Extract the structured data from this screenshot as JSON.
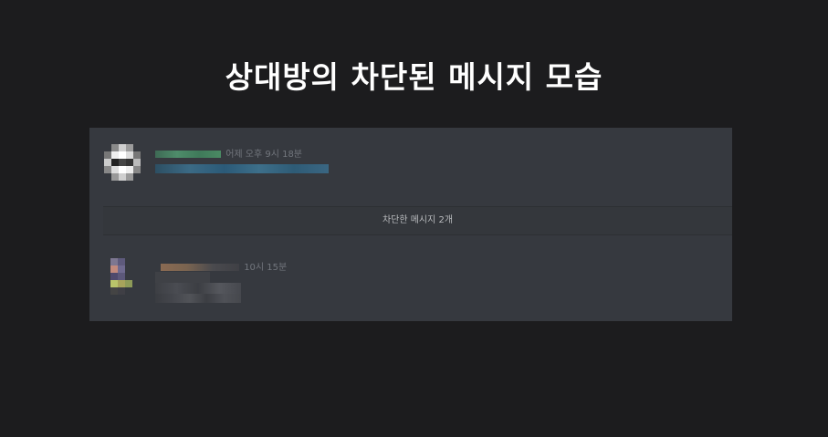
{
  "page": {
    "title": "상대방의 차단된 메시지 모습"
  },
  "messages": [
    {
      "timestamp": "어제 오후 9시 18분"
    },
    {
      "timestamp": "10시 15분"
    }
  ],
  "blocked_notice": {
    "label": "차단한 메시지 2개"
  },
  "colors": {
    "background": "#1c1c1e",
    "panel": "#36393f",
    "timestamp": "#72767d",
    "username_green": "#43b581",
    "link_blue": "#00b0f4"
  }
}
